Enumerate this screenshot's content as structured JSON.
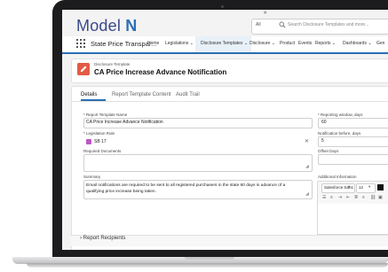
{
  "header": {
    "logo_model": "Model ",
    "logo_n": "N",
    "search_scope": "All",
    "search_placeholder": "Search Disclosure Templates and more...",
    "favorite": "★"
  },
  "nav": {
    "app_name": "State Price Transpar...",
    "items": [
      "Home",
      "Legislations",
      "Disclosure Templates",
      "Disclosure",
      "Product",
      "Events",
      "Reports",
      "Dashboards",
      "Gen"
    ],
    "active_index": 2
  },
  "record": {
    "kicker": "Disclosure Template",
    "title": "CA Price Increase Advance Notification"
  },
  "tabs": [
    "Details",
    "Report Template Content",
    "Audit Trail"
  ],
  "active_tab": 0,
  "fields": {
    "report_template_name_label": "* Report Template Name",
    "report_template_name_value": "CA Price Increase Advance Notification",
    "legislation_rule_label": "* Legislation Rule",
    "legislation_rule_value": "SB 17",
    "required_documents_label": "Required Documents",
    "summary_label": "Summary",
    "summary_value": "Email notifications are required to be sent to all registered purchasers in the state 60 days in advance of a qualifying price increase being taken.",
    "reporting_window_label": "* Reporting window, days",
    "reporting_window_value": "60",
    "notification_before_label": "Notification before, days",
    "notification_before_value": "5",
    "offset_days_label": "Offset Days",
    "additional_info_label": "Additional Information"
  },
  "editor": {
    "font_family": "Salesforce Sans",
    "font_size": "12"
  },
  "sections": {
    "report_recipients": "Report Recipients"
  },
  "colors": {
    "brand_blue": "#2a6fb4",
    "record_icon": "#e35b44",
    "lookup_icon": "#c055c6"
  }
}
